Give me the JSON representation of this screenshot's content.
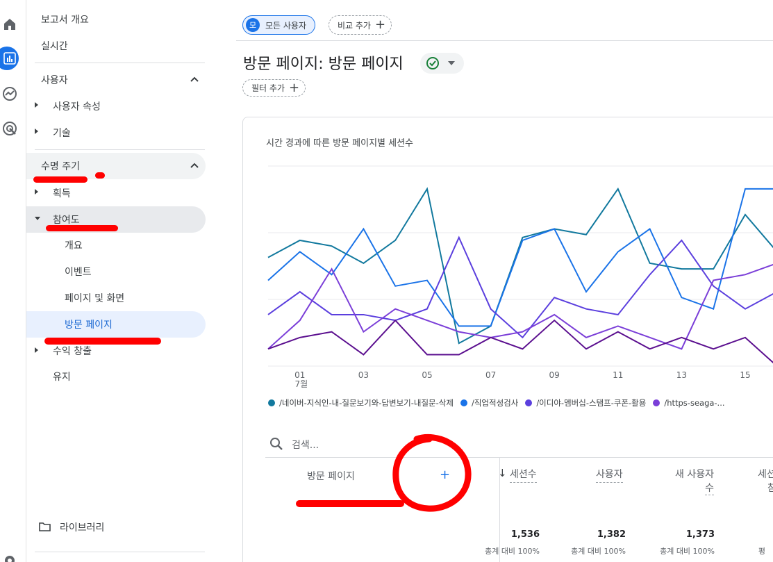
{
  "nav": {
    "report_overview": "보고서 개요",
    "realtime": "실시간",
    "user_section": "사용자",
    "user_attributes": "사용자 속성",
    "tech": "기술",
    "lifecycle_section": "수명 주기",
    "acquisition": "획득",
    "engagement": "참여도",
    "overview": "개요",
    "events": "이벤트",
    "pages_screens": "페이지 및 화면",
    "landing_page": "방문 페이지",
    "monetization": "수익 창출",
    "retention": "유지",
    "library": "라이브러리"
  },
  "toolbar": {
    "segment_avatar": "모",
    "segment_label": "모든 사용자",
    "add_comparison": "비교 추가",
    "add_filter": "필터 추가"
  },
  "page": {
    "title": "방문 페이지: 방문 페이지"
  },
  "chart_card": {
    "title": "시간 경과에 따른 방문 페이지별 세션수"
  },
  "chart_data": {
    "type": "line",
    "x_ticks": [
      "01",
      "03",
      "05",
      "07",
      "09",
      "11",
      "13",
      "15"
    ],
    "x_month_label": "7월",
    "x": [
      1,
      2,
      3,
      4,
      5,
      6,
      7,
      8,
      9,
      10,
      11,
      12,
      13,
      14,
      15,
      16
    ],
    "grid": true,
    "series": [
      {
        "name": "/네이버-지식인-내-질문보기와-답변보기-내질문-삭제",
        "color": "#12799e",
        "values": [
          38,
          44,
          42,
          36,
          44,
          62,
          8,
          14,
          45,
          48,
          46,
          62,
          36,
          34,
          34,
          53,
          40
        ]
      },
      {
        "name": "/직업적성검사",
        "color": "#1a73e8",
        "values": [
          30,
          40,
          32,
          48,
          28,
          30,
          14,
          14,
          44,
          48,
          26,
          40,
          48,
          24,
          20,
          62,
          62
        ]
      },
      {
        "name": "/이디야-멤버십-스탬프-쿠폰-활용",
        "color": "#5b3fde",
        "values": [
          18,
          26,
          18,
          18,
          16,
          20,
          45,
          20,
          10,
          24,
          20,
          18,
          32,
          44,
          28,
          20,
          26
        ]
      },
      {
        "name": "/https-seaga-...",
        "color": "#7b3fd8",
        "values": [
          6,
          16,
          34,
          12,
          20,
          16,
          12,
          10,
          12,
          18,
          10,
          14,
          10,
          6,
          30,
          32,
          36
        ]
      },
      {
        "name": "",
        "color": "#5b0f8f",
        "values": [
          6,
          10,
          12,
          4,
          16,
          4,
          4,
          10,
          6,
          16,
          6,
          12,
          6,
          10,
          6,
          10,
          0
        ]
      }
    ]
  },
  "search": {
    "placeholder": "검색..."
  },
  "table": {
    "dimension_header": "방문 페이지",
    "columns": [
      {
        "label": "세션수",
        "total": "1,536",
        "pct": "총계 대비 100%"
      },
      {
        "label": "사용자",
        "total": "1,382",
        "pct": "총계 대비 100%"
      },
      {
        "label_line1": "새 사용자",
        "label_line2": "수",
        "total": "1,373",
        "pct": "총계 대비 100%"
      },
      {
        "label_line1": "세션",
        "label_line2": "참",
        "total": "",
        "pct": "평"
      }
    ]
  },
  "colors": {
    "accent": "#1a73e8",
    "annotation": "#ff0000"
  }
}
